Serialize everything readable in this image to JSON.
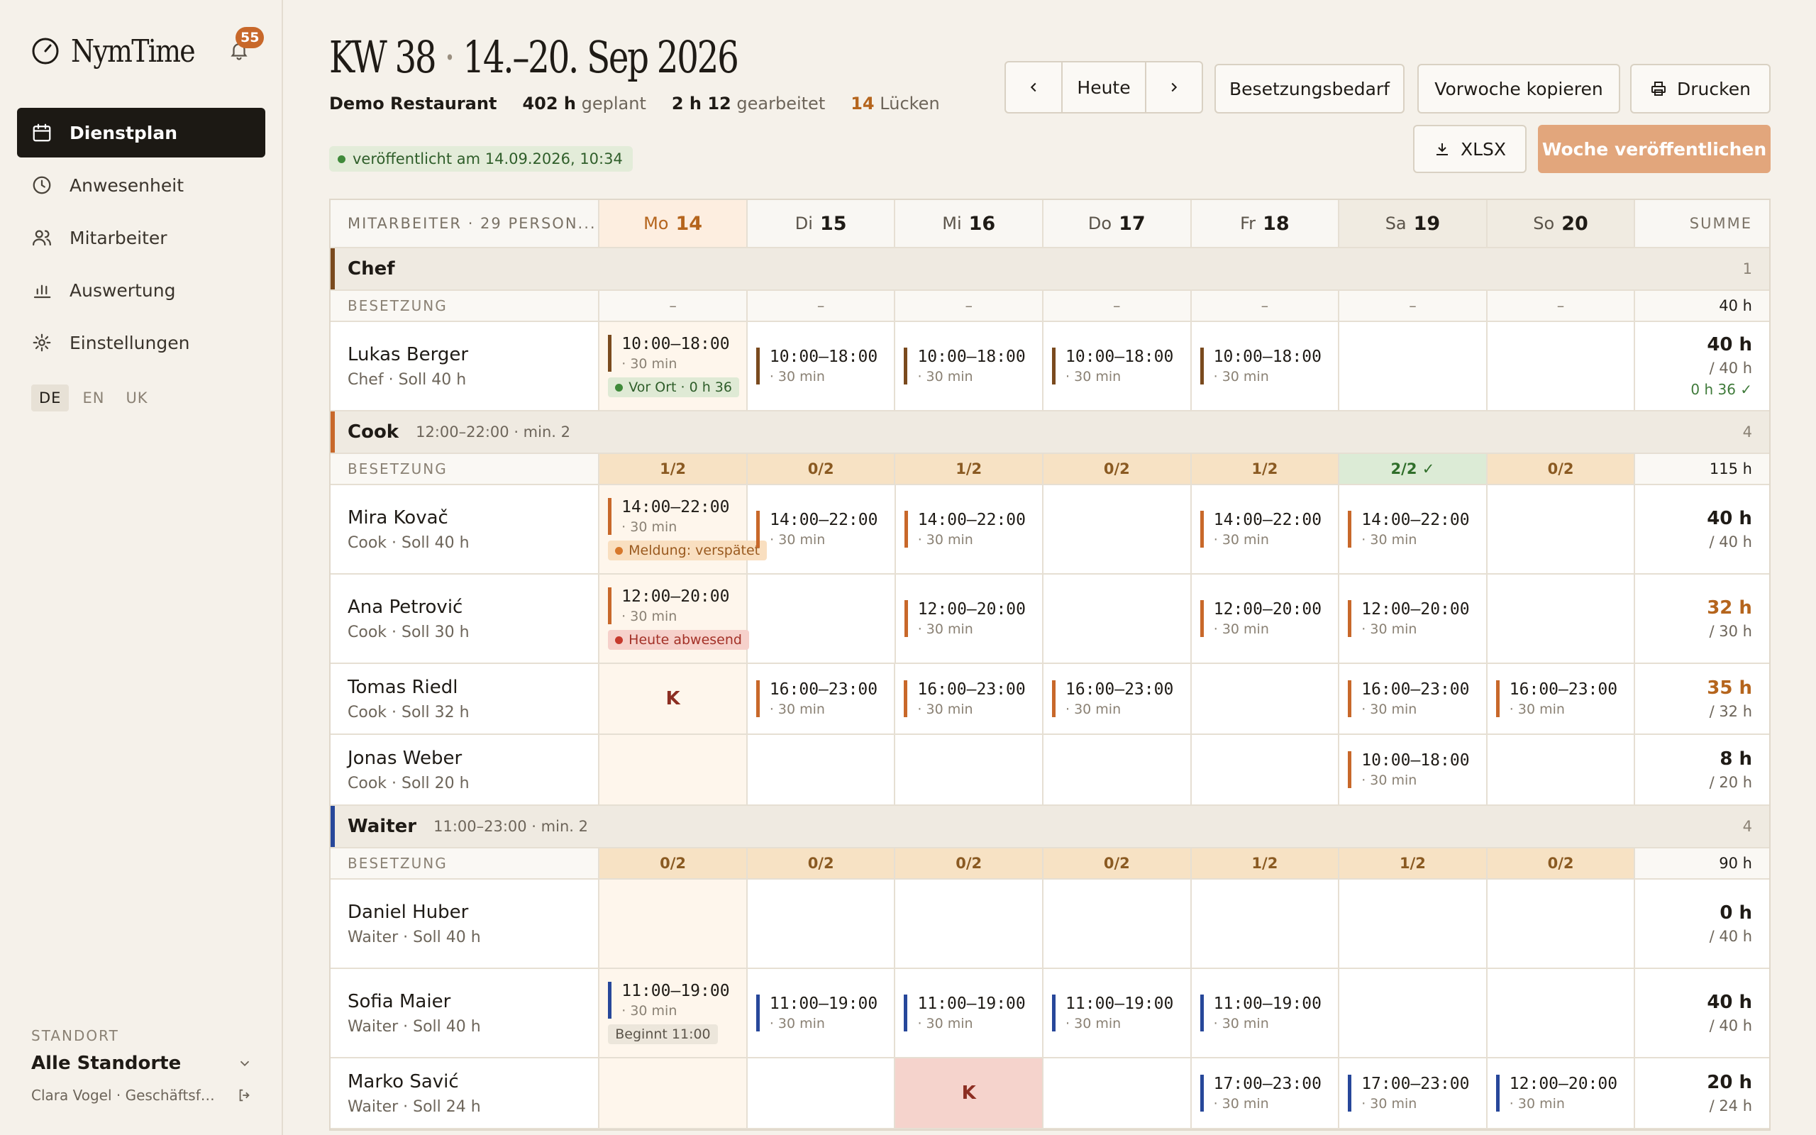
{
  "app": {
    "name": "NymTime",
    "notifications": "55"
  },
  "nav": [
    {
      "label": "Dienstplan",
      "icon": "calendar-icon",
      "active": true
    },
    {
      "label": "Anwesenheit",
      "icon": "clock-icon"
    },
    {
      "label": "Mitarbeiter",
      "icon": "users-icon"
    },
    {
      "label": "Auswertung",
      "icon": "chart-icon"
    },
    {
      "label": "Einstellungen",
      "icon": "gear-icon"
    }
  ],
  "langs": [
    "DE",
    "EN",
    "UK"
  ],
  "standort": {
    "label": "STANDORT",
    "value": "Alle Standorte",
    "user": "Clara Vogel · Geschäftsfü..."
  },
  "header": {
    "week": "KW 38",
    "sep": "·",
    "range": "14.–20. Sep 2026",
    "restaurant": "Demo Restaurant",
    "planned_value": "402 h",
    "planned_label": "geplant",
    "worked_value": "2 h 12",
    "worked_label": "gearbeitet",
    "gaps_value": "14",
    "gaps_label": "Lücken",
    "published": "veröffentlicht am 14.09.2026, 10:34"
  },
  "toolbar": {
    "today": "Heute",
    "demand": "Besetzungsbedarf",
    "copy": "Vorwoche kopieren",
    "print": "Drucken",
    "xlsx": "XLSX",
    "publish": "Woche veröffentlichen"
  },
  "grid": {
    "emp_header": "MITARBEITER · 29 PERSON...",
    "sum_header": "SUMME",
    "staffing_label": "BESETZUNG",
    "days": [
      {
        "d": "Mo",
        "n": "14"
      },
      {
        "d": "Di",
        "n": "15"
      },
      {
        "d": "Mi",
        "n": "16"
      },
      {
        "d": "Do",
        "n": "17"
      },
      {
        "d": "Fr",
        "n": "18"
      },
      {
        "d": "Sa",
        "n": "19"
      },
      {
        "d": "So",
        "n": "20"
      }
    ]
  },
  "groups": [
    {
      "name": "Chef",
      "info": "",
      "count": "1",
      "color": "#7a4a1e",
      "staffing": [
        "–",
        "–",
        "–",
        "–",
        "–",
        "–",
        "–"
      ],
      "staffing_total": "40 h",
      "employees": [
        {
          "name": "Lukas Berger",
          "sub": "Chef · Soll 40 h",
          "days": [
            {
              "t": "10:00–18:00",
              "b": "· 30 min",
              "tag": {
                "text": "Vor Ort · 0 h 36",
                "kind": "green"
              }
            },
            {
              "t": "10:00–18:00",
              "b": "· 30 min"
            },
            {
              "t": "10:00–18:00",
              "b": "· 30 min"
            },
            {
              "t": "10:00–18:00",
              "b": "· 30 min"
            },
            {
              "t": "10:00–18:00",
              "b": "· 30 min"
            },
            null,
            null
          ],
          "sum": "40 h",
          "soll": "/ 40 h",
          "check": "0 h 36 ✓",
          "warn": false
        }
      ]
    },
    {
      "name": "Cook",
      "info": "12:00–22:00 · min. 2",
      "count": "4",
      "color": "#c8682a",
      "staffing": [
        "1/2",
        "0/2",
        "1/2",
        "0/2",
        "1/2",
        "2/2 ✓",
        "0/2"
      ],
      "staffing_total": "115 h",
      "employees": [
        {
          "name": "Mira Kovač",
          "sub": "Cook · Soll 40 h",
          "days": [
            {
              "t": "14:00–22:00",
              "b": "· 30 min",
              "tag": {
                "text": "Meldung: verspätet",
                "kind": "orange"
              }
            },
            {
              "t": "14:00–22:00",
              "b": "· 30 min"
            },
            {
              "t": "14:00–22:00",
              "b": "· 30 min"
            },
            null,
            {
              "t": "14:00–22:00",
              "b": "· 30 min"
            },
            {
              "t": "14:00–22:00",
              "b": "· 30 min"
            },
            null
          ],
          "sum": "40 h",
          "soll": "/ 40 h",
          "warn": false
        },
        {
          "name": "Ana Petrović",
          "sub": "Cook · Soll 30 h",
          "days": [
            {
              "t": "12:00–20:00",
              "b": "· 30 min",
              "tag": {
                "text": "Heute abwesend",
                "kind": "red"
              }
            },
            null,
            {
              "t": "12:00–20:00",
              "b": "· 30 min"
            },
            null,
            {
              "t": "12:00–20:00",
              "b": "· 30 min"
            },
            {
              "t": "12:00–20:00",
              "b": "· 30 min"
            },
            null
          ],
          "sum": "32 h",
          "soll": "/ 30 h",
          "warn": true
        },
        {
          "name": "Tomas Riedl",
          "sub": "Cook · Soll 32 h",
          "days": [
            {
              "absence": "K"
            },
            {
              "t": "16:00–23:00",
              "b": "· 30 min"
            },
            {
              "t": "16:00–23:00",
              "b": "· 30 min"
            },
            {
              "t": "16:00–23:00",
              "b": "· 30 min"
            },
            null,
            {
              "t": "16:00–23:00",
              "b": "· 30 min"
            },
            {
              "t": "16:00–23:00",
              "b": "· 30 min"
            }
          ],
          "sum": "35 h",
          "soll": "/ 32 h",
          "warn": true
        },
        {
          "name": "Jonas Weber",
          "sub": "Cook · Soll 20 h",
          "days": [
            null,
            null,
            null,
            null,
            null,
            {
              "t": "10:00–18:00",
              "b": "· 30 min"
            },
            null
          ],
          "sum": "8 h",
          "soll": "/ 20 h",
          "warn": false
        }
      ]
    },
    {
      "name": "Waiter",
      "info": "11:00–23:00 · min. 2",
      "count": "4",
      "color": "#27479a",
      "staffing": [
        "0/2",
        "0/2",
        "0/2",
        "0/2",
        "1/2",
        "1/2",
        "0/2"
      ],
      "staffing_total": "90 h",
      "employees": [
        {
          "name": "Daniel Huber",
          "sub": "Waiter · Soll 40 h",
          "days": [
            null,
            null,
            null,
            null,
            null,
            null,
            null
          ],
          "sum": "0 h",
          "soll": "/ 40 h",
          "warn": false
        },
        {
          "name": "Sofia Maier",
          "sub": "Waiter · Soll 40 h",
          "days": [
            {
              "t": "11:00–19:00",
              "b": "· 30 min",
              "tag": {
                "text": "Beginnt 11:00",
                "kind": "grey"
              }
            },
            {
              "t": "11:00–19:00",
              "b": "· 30 min"
            },
            {
              "t": "11:00–19:00",
              "b": "· 30 min"
            },
            {
              "t": "11:00–19:00",
              "b": "· 30 min"
            },
            {
              "t": "11:00–19:00",
              "b": "· 30 min"
            },
            null,
            null
          ],
          "sum": "40 h",
          "soll": "/ 40 h",
          "warn": false
        },
        {
          "name": "Marko Savić",
          "sub": "Waiter · Soll 24 h",
          "days": [
            null,
            null,
            {
              "absence": "K",
              "sick": true
            },
            null,
            {
              "t": "17:00–23:00",
              "b": "· 30 min"
            },
            {
              "t": "17:00–23:00",
              "b": "· 30 min"
            },
            {
              "t": "12:00–20:00",
              "b": "· 30 min"
            }
          ],
          "sum": "20 h",
          "soll": "/ 24 h",
          "warn": false
        }
      ]
    }
  ]
}
